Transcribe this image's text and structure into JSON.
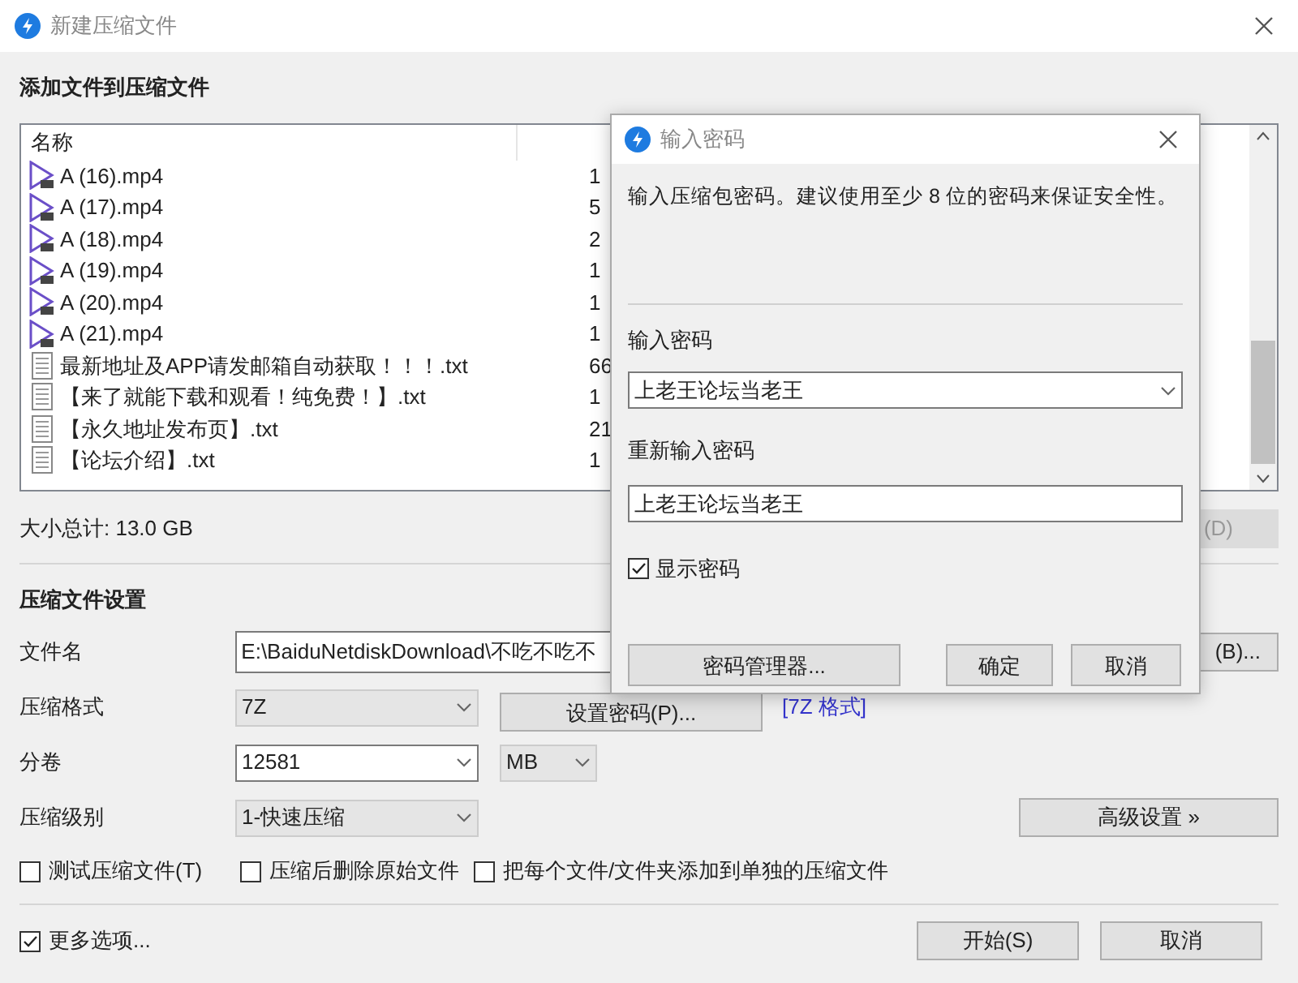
{
  "window": {
    "title": "新建压缩文件"
  },
  "main": {
    "section_title": "添加文件到压缩文件",
    "list": {
      "columns": [
        "名称"
      ],
      "rows": [
        {
          "name": "A (16).mp4",
          "kind": "video",
          "size": "1"
        },
        {
          "name": "A (17).mp4",
          "kind": "video",
          "size": "5"
        },
        {
          "name": "A (18).mp4",
          "kind": "video",
          "size": "2"
        },
        {
          "name": "A (19).mp4",
          "kind": "video",
          "size": "1"
        },
        {
          "name": "A (20).mp4",
          "kind": "video",
          "size": "1"
        },
        {
          "name": "A (21).mp4",
          "kind": "video",
          "size": "1"
        },
        {
          "name": "最新地址及APP请发邮箱自动获取！！！.txt",
          "kind": "text",
          "size": "66"
        },
        {
          "name": "【来了就能下载和观看！纯免费！】.txt",
          "kind": "text",
          "size": "1"
        },
        {
          "name": "【永久地址发布页】.txt",
          "kind": "text",
          "size": "21"
        },
        {
          "name": "【论坛介绍】.txt",
          "kind": "text",
          "size": "1"
        }
      ]
    },
    "total": "大小总计: 13.0 GB",
    "delete_button": {
      "label": "(D)",
      "disabled": true
    },
    "settings_title": "压缩文件设置",
    "filename": {
      "label": "文件名",
      "value": "E:\\BaiduNetdiskDownload\\不吃不吃不"
    },
    "browse_button": "(B)...",
    "format": {
      "label": "压缩格式",
      "value": "7Z"
    },
    "password_button": "设置密码(P)...",
    "format_link": "[7Z 格式]",
    "split": {
      "label": "分卷",
      "value": "12581",
      "unit": "MB"
    },
    "level": {
      "label": "压缩级别",
      "value": "1-快速压缩"
    },
    "advanced_button": "高级设置 »",
    "options": [
      {
        "label": "测试压缩文件(T)",
        "checked": false
      },
      {
        "label": "压缩后删除原始文件",
        "checked": false
      },
      {
        "label": "把每个文件/文件夹添加到单独的压缩文件",
        "checked": false
      }
    ],
    "more_options": {
      "label": "更多选项...",
      "checked": true
    },
    "buttons": [
      "开始(S)",
      "取消"
    ]
  },
  "dialog": {
    "title": "输入密码",
    "description": "输入压缩包密码。建议使用至少 8 位的密码来保证安全性。",
    "password_label": "输入密码",
    "password_value": "上老王论坛当老王",
    "confirm_label": "重新输入密码",
    "confirm_value": "上老王论坛当老王",
    "show_password": {
      "label": "显示密码",
      "checked": true
    },
    "buttons": [
      "密码管理器...",
      "确定",
      "取消"
    ]
  }
}
